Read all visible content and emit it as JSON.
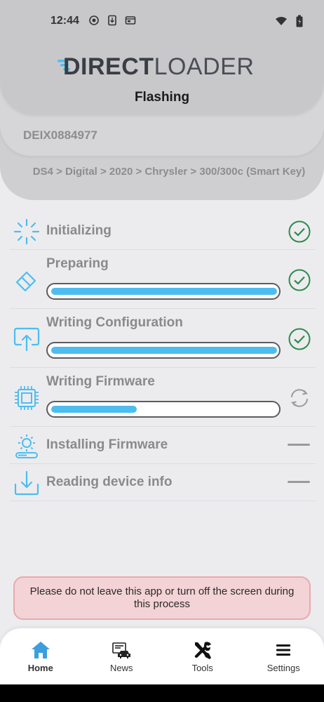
{
  "status_bar": {
    "time": "12:44"
  },
  "header": {
    "logo_direct": "DIRECT",
    "logo_loader": "LOADER",
    "title": "Flashing",
    "serial": "DEIX0884977",
    "breadcrumb": "DS4 > Digital > 2020 > Chrysler > 300/300c (Smart Key)"
  },
  "steps": [
    {
      "label": "Initializing",
      "icon": "spinner-icon",
      "status": "done"
    },
    {
      "label": "Preparing",
      "icon": "eraser-icon",
      "status": "done",
      "progress": 1.0
    },
    {
      "label": "Writing Configuration",
      "icon": "upload-icon",
      "status": "done",
      "progress": 1.0
    },
    {
      "label": "Writing Firmware",
      "icon": "chip-icon",
      "status": "in-progress",
      "progress": 0.38
    },
    {
      "label": "Installing Firmware",
      "icon": "gear-install-icon",
      "status": "pending"
    },
    {
      "label": "Reading device info",
      "icon": "download-icon",
      "status": "pending"
    }
  ],
  "warning": "Please do not leave this app or turn off the screen during this process",
  "nav": [
    {
      "label": "Home",
      "icon": "home-icon",
      "active": true
    },
    {
      "label": "News",
      "icon": "news-icon",
      "active": false
    },
    {
      "label": "Tools",
      "icon": "tools-icon",
      "active": false
    },
    {
      "label": "Settings",
      "icon": "menu-icon",
      "active": false
    }
  ],
  "colors": {
    "accent": "#4dbdf0",
    "success": "#2e8b4a",
    "warning_bg": "#f3d3d5",
    "nav_active": "#3a9ee0"
  }
}
